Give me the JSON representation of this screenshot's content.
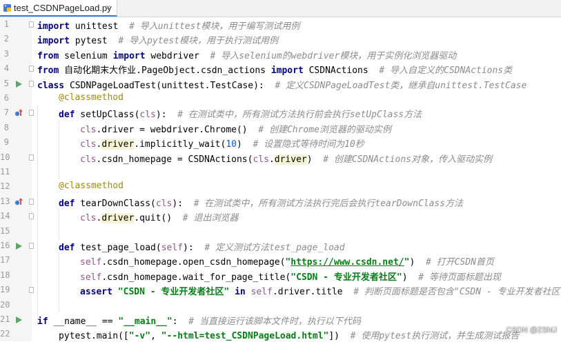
{
  "tab": {
    "filename": "test_CSDNPageLoad.py",
    "close": "×"
  },
  "lines": [
    {
      "n": "1"
    },
    {
      "n": "2"
    },
    {
      "n": "3"
    },
    {
      "n": "4"
    },
    {
      "n": "5"
    },
    {
      "n": "6"
    },
    {
      "n": "7"
    },
    {
      "n": "8"
    },
    {
      "n": "9"
    },
    {
      "n": "10"
    },
    {
      "n": "11"
    },
    {
      "n": "12"
    },
    {
      "n": "13"
    },
    {
      "n": "14"
    },
    {
      "n": "15"
    },
    {
      "n": "16"
    },
    {
      "n": "17"
    },
    {
      "n": "18"
    },
    {
      "n": "19"
    },
    {
      "n": "20"
    },
    {
      "n": "21"
    },
    {
      "n": "22"
    }
  ],
  "code": {
    "l1": {
      "kw": "import",
      "t": " unittest  ",
      "c": "# 导入unittest模块，用于编写测试用例"
    },
    "l2": {
      "kw": "import",
      "t": " pytest  ",
      "c": "# 导入pytest模块，用于执行测试用例"
    },
    "l3": {
      "kw1": "from",
      "t1": " selenium ",
      "kw2": "import",
      "t2": " webdriver  ",
      "c": "# 导入selenium的webdriver模块，用于实例化浏览器驱动"
    },
    "l4": {
      "kw1": "from",
      "t1": " 自动化期末大作业.PageObject.csdn_actions ",
      "kw2": "import",
      "t2": " CSDNActions  ",
      "c": "# 导入自定义的CSDNActions类"
    },
    "l5": {
      "kw": "class",
      "t": " CSDNPageLoadTest(unittest.TestCase):  ",
      "c": "# 定义CSDNPageLoadTest类，继承自unittest.TestCase"
    },
    "l6": {
      "dec": "@classmethod"
    },
    "l7": {
      "kw": "def",
      "t1": " setUpClass(",
      "self": "cls",
      "t2": "):  ",
      "c": "# 在测试类中，所有测试方法执行前会执行setUpClass方法"
    },
    "l8": {
      "self": "cls",
      "t": ".driver = webdriver.Chrome()  ",
      "c": "# 创建Chrome浏览器的驱动实例"
    },
    "l9": {
      "self": "cls",
      "t1": ".",
      "hl": "driver",
      "t2": ".implicitly_wait(",
      "num": "10",
      "t3": ")  ",
      "c": "# 设置隐式等待时间为10秒"
    },
    "l10": {
      "self1": "cls",
      "t1": ".csdn_homepage = CSDNActions(",
      "self2": "cls",
      "t2": ".",
      "hl": "driver",
      "t3": ")  ",
      "c": "# 创建CSDNActions对象，传入驱动实例"
    },
    "l12": {
      "dec": "@classmethod"
    },
    "l13": {
      "kw": "def",
      "t1": " tearDownClass(",
      "self": "cls",
      "t2": "):  ",
      "c": "# 在测试类中，所有测试方法执行完后会执行tearDownClass方法"
    },
    "l14": {
      "self": "cls",
      "t1": ".",
      "hl": "driver",
      "t2": ".quit()  ",
      "c": "# 退出浏览器"
    },
    "l16": {
      "kw": "def",
      "t1": " test_page_load(",
      "self": "self",
      "t2": "):  ",
      "c": "# 定义测试方法test_page_load"
    },
    "l17": {
      "self": "self",
      "t1": ".csdn_homepage.open_csdn_homepage(",
      "q1": "\"",
      "link": "https://www.csdn.net/",
      "q2": "\"",
      "t2": ")  ",
      "c": "# 打开CSDN首页"
    },
    "l18": {
      "self": "self",
      "t1": ".csdn_homepage.wait_for_page_title(",
      "str": "\"CSDN - 专业开发者社区\"",
      "t2": ")  ",
      "c": "# 等待页面标题出现"
    },
    "l19": {
      "kw1": "assert",
      "t1": " ",
      "str": "\"CSDN - 专业开发者社区\"",
      "t2": " ",
      "kw2": "in",
      "t3": " ",
      "self": "self",
      "t4": ".driver.title  ",
      "c": "# 判断页面标题是否包含\"CSDN - 专业开发者社区\""
    },
    "l21": {
      "kw1": "if",
      "t1": " __name__ == ",
      "str": "\"__main__\"",
      "t2": ":  ",
      "c": "# 当直接运行该脚本文件时，执行以下代码"
    },
    "l22": {
      "t1": "pytest.main([",
      "s1": "\"-v\"",
      "t2": ", ",
      "s2": "\"--html=test_CSDNPageLoad.html\"",
      "t3": "])  ",
      "c": "# 使用pytest执行测试，并生成测试报告"
    }
  },
  "watermark": "CSDN @ZShiJ",
  "colors": {
    "keyword": "#000080",
    "string": "#067d17",
    "comment": "#8c8c8c",
    "decorator": "#9e880d",
    "self": "#94558d",
    "number": "#1750eb",
    "run": "#59a869"
  }
}
